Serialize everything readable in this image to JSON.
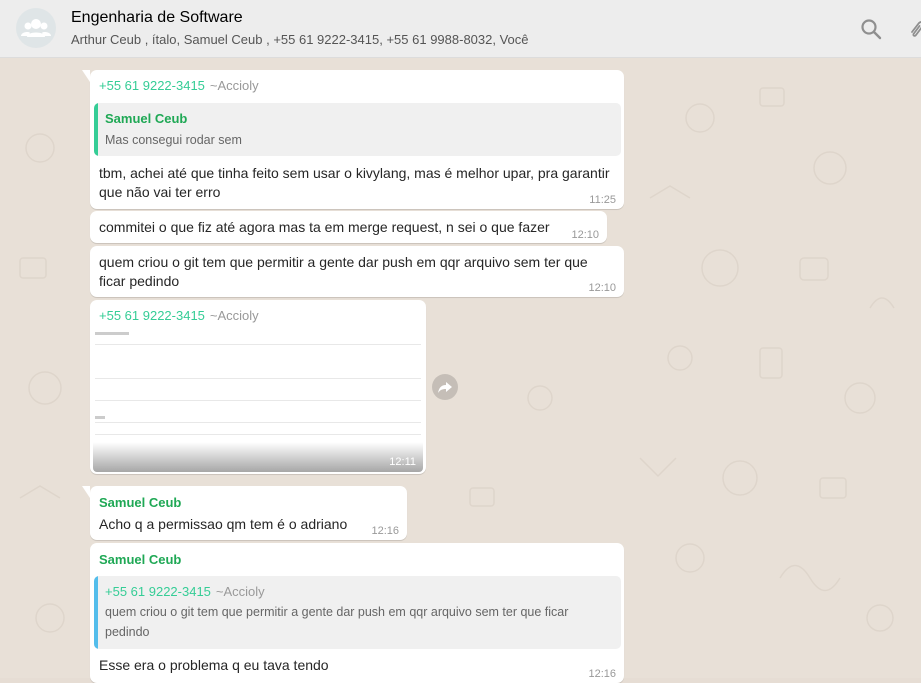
{
  "header": {
    "title": "Engenharia de Software",
    "participants": "Arthur Ceub , ítalo, Samuel Ceub , +55 61 9222-3415, +55 61 9988-8032, Você",
    "icons": [
      "group-avatar-icon",
      "search-icon",
      "attach-icon"
    ]
  },
  "messages": [
    {
      "sender": "+55 61 9222-3415",
      "alias": "~Accioly",
      "quote_author": "Samuel Ceub",
      "quote_text": "Mas consegui rodar sem",
      "text_line1": "tbm, achei até que tinha feito sem usar o kivylang, mas é melhor upar, pra garantir",
      "text_line2": "que não vai ter erro",
      "time": "11:25"
    },
    {
      "text": "commitei o que fiz até agora mas ta em merge request, n sei o que fazer",
      "time": "12:10"
    },
    {
      "text_line1": "quem criou o git tem que permitir a gente dar push em qqr arquivo sem ter que",
      "text_line2": "ficar pedindo",
      "time": "12:10"
    },
    {
      "sender": "+55 61 9222-3415",
      "alias": "~Accioly",
      "time": "12:11"
    },
    {
      "sender": "Samuel Ceub",
      "text": "Acho q a permissao qm tem é o adriano",
      "time": "12:16"
    },
    {
      "sender": "Samuel Ceub",
      "quote_author": "+55 61 9222-3415",
      "quote_alias": "~Accioly",
      "quote_text_line1": "quem criou o git tem que permitir a gente dar push em qqr arquivo sem ter que ficar",
      "quote_text_line2": "pedindo",
      "text": "Esse era o problema q eu tava tendo",
      "time": "12:16"
    }
  ],
  "colors": {
    "sender_number": "#35cd96",
    "sender_name": "#1fa855",
    "quote_bar_green": "#35cd96",
    "quote_bar_blue": "#53bdeb",
    "header_bg": "#ededed",
    "wallpaper": "#e8e0d7"
  }
}
